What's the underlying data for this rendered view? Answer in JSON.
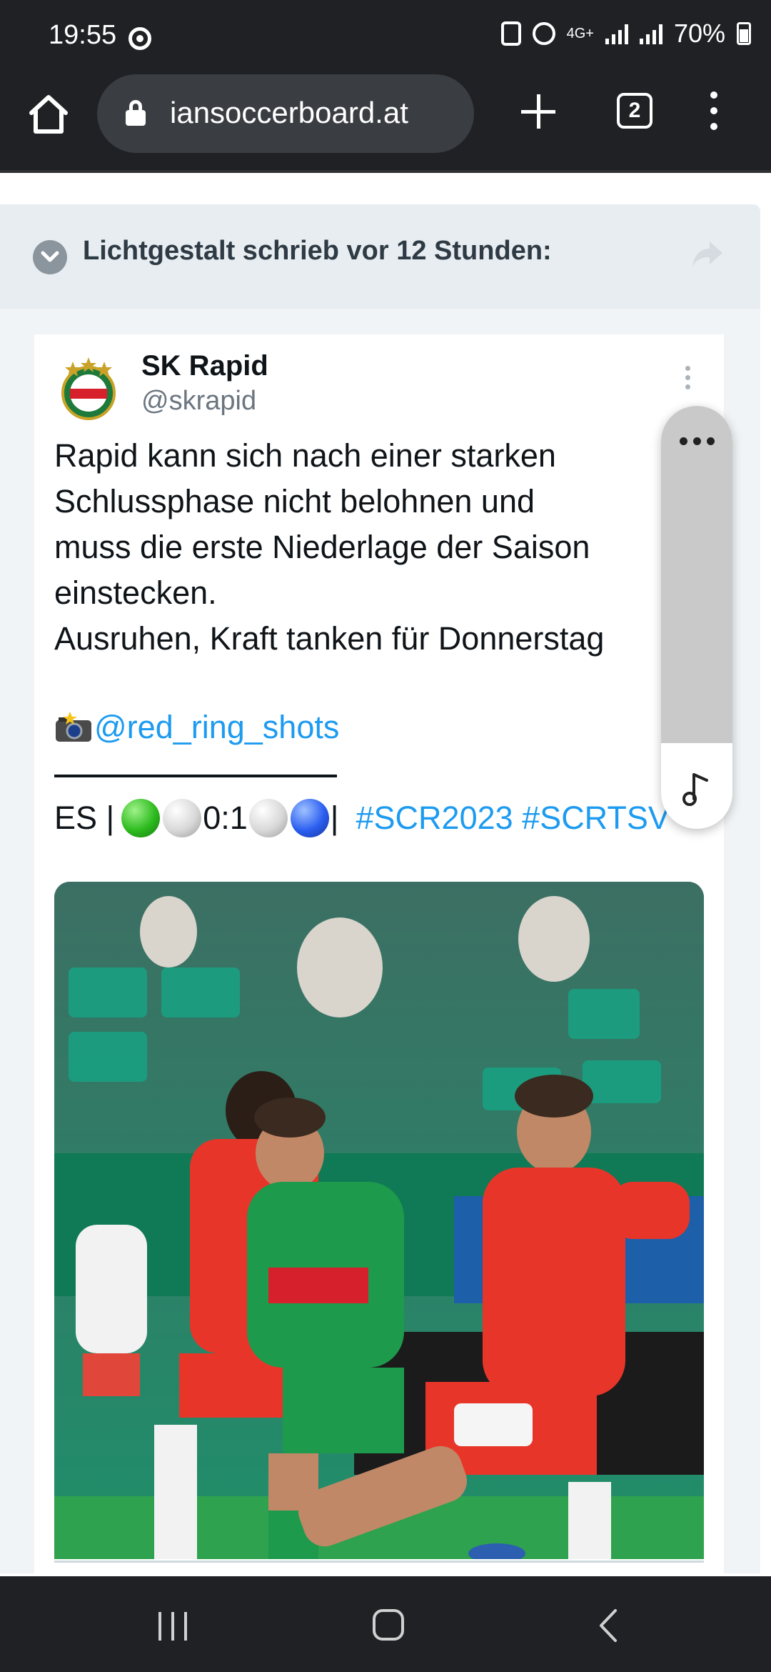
{
  "status_bar": {
    "time": "19:55",
    "network": "4G+",
    "battery": "70%"
  },
  "browser": {
    "url": "iansoccerboard.at",
    "tab_count": "2"
  },
  "forum_quote": {
    "author_line": "Lichtgestalt schrieb vor 12 Stunden:"
  },
  "tweet": {
    "account_name": "SK Rapid",
    "handle": "@skrapid",
    "text": "Rapid kann sich nach einer starken\nSchlussphase nicht belohnen und\nmuss die erste Niederlage der Saison\neinstecken.\nAusruhen, Kraft tanken für Donnerstag",
    "credit": "@red_ring_shots",
    "score_prefix": "ES |",
    "score": "0:1",
    "score_suffix": "|",
    "hashtags": "#SCR2023 #SCRTSV"
  },
  "colors": {
    "browser_chrome": "#1f2125",
    "quote_header_bg": "#e8edf1",
    "link_blue": "#1d9bf0",
    "pitch_green": "#2a7d5c"
  },
  "icons": {
    "home": "home-icon",
    "lock": "lock-icon",
    "new_tab": "plus-icon",
    "tabs": "tab-switcher-icon",
    "menu": "more-vert-icon",
    "expand": "chevron-down-icon",
    "share": "share-arrow-icon",
    "camera": "camera-flash-icon",
    "music": "music-note-icon"
  }
}
